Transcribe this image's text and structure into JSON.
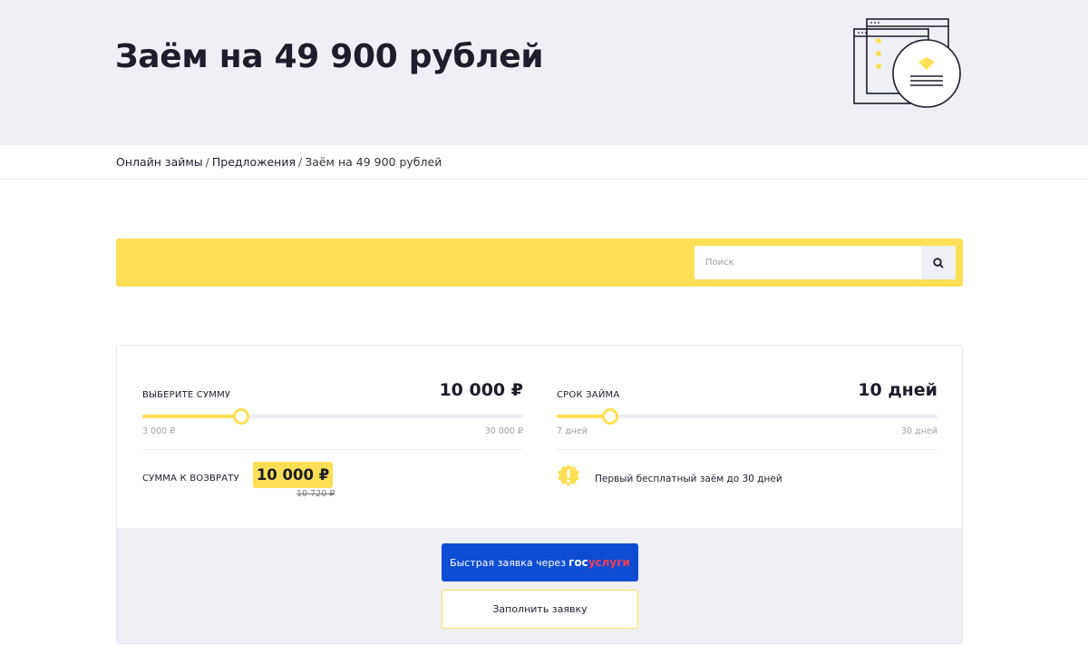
{
  "page": {
    "title": "Заём на 49 900 рублей"
  },
  "breadcrumb": {
    "items": [
      "Онлайн займы",
      "Предложения"
    ],
    "separator": "/",
    "current": "Заём на 49 900 рублей"
  },
  "search": {
    "placeholder": "Поиск",
    "icon": "search-icon"
  },
  "calculator": {
    "amount": {
      "label": "ВЫБЕРИТЕ СУММУ",
      "value": "10 000 ₽",
      "min_label": "3 000 ₽",
      "max_label": "30 000 ₽",
      "slider_fraction": 0.26
    },
    "term": {
      "label": "СРОК ЗАЙМА",
      "value": "10 дней",
      "min_label": "7 дней",
      "max_label": "30 дней",
      "slider_fraction": 0.14
    },
    "return": {
      "label": "СУММА К ВОЗВРАТУ",
      "value": "10 000 ₽",
      "old_value": "10 720 ₽"
    },
    "promo": {
      "icon": "exclamation-badge-icon",
      "text": "Первый бесплатный заём до 30 дней"
    }
  },
  "actions": {
    "gosuslugi": {
      "label": "Быстрая заявка через",
      "logo_part1": "гос",
      "logo_part2": "услуги"
    },
    "fill_form": "Заполнить заявку"
  },
  "colors": {
    "accent_yellow": "#ffdf55",
    "gosuslugi_blue": "#0d4cd3",
    "gosuslugi_red": "#ee3f58",
    "hero_bg": "#eef0f6",
    "text_dark": "#1d1d2b"
  }
}
